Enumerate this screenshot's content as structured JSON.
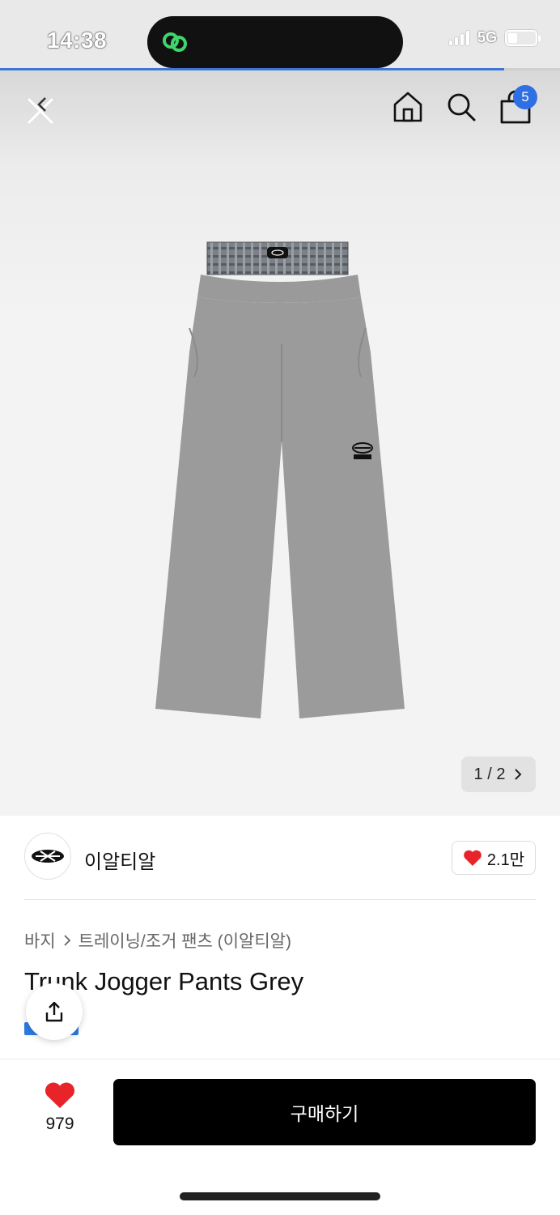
{
  "status_bar": {
    "time": "14:38",
    "network": "5G",
    "battery_level": 0.35,
    "page_load_progress": 0.9
  },
  "nav": {
    "cart_count": "5"
  },
  "gallery": {
    "pager_text": "1 / 2",
    "pager_next_icon": "chevron-right-icon"
  },
  "seller": {
    "name": "이알티알",
    "logo_text": "ERTR",
    "likes": "2.1만"
  },
  "breadcrumb": {
    "category": "바지",
    "subcategory": "트레이닝/조거 팬츠 (이알티알)"
  },
  "product": {
    "title": "Trunk Jogger Pants Grey"
  },
  "bottom_bar": {
    "wish_count": "979",
    "buy_label": "구매하기"
  },
  "colors": {
    "accent_blue": "#2f6fe4",
    "heart_red": "#e8232a",
    "buy_button": "#000000"
  }
}
